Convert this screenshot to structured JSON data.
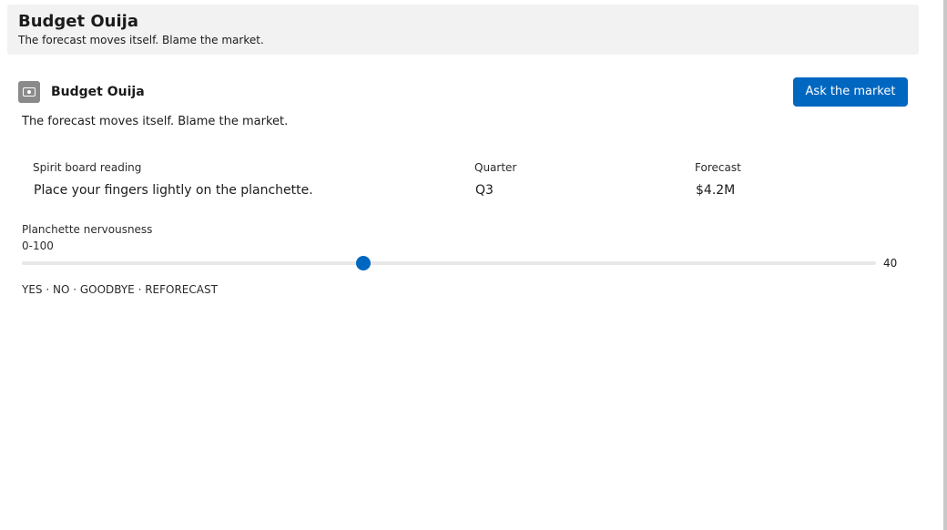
{
  "header": {
    "title": "Budget Ouija",
    "subtitle": "The forecast moves itself. Blame the market."
  },
  "panel": {
    "icon": "cash-icon",
    "title": "Budget Ouija",
    "action_label": "Ask the market",
    "description": "The forecast moves itself. Blame the market."
  },
  "fields": {
    "reading": {
      "label": "Spirit board reading",
      "value": "Place your fingers lightly on the planchette."
    },
    "quarter": {
      "label": "Quarter",
      "value": "Q3"
    },
    "forecast": {
      "label": "Forecast",
      "value": "$4.2M"
    }
  },
  "slider": {
    "label": "Planchette nervousness",
    "range_text": "0-100",
    "min": 0,
    "max": 100,
    "value": 40,
    "value_text": "40",
    "accent": "#0067c0"
  },
  "footer": {
    "answers": "YES · NO · GOODBYE · REFORECAST"
  }
}
